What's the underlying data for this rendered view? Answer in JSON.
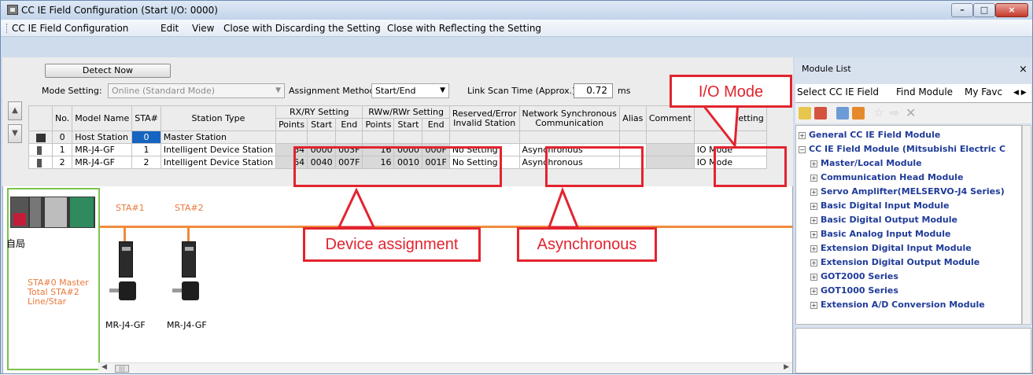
{
  "window": {
    "title": "CC IE Field Configuration (Start I/O: 0000)",
    "controls": {
      "minimize": "–",
      "maximize": "□",
      "close": "×"
    }
  },
  "menu": [
    "CC IE Field Configuration",
    "Edit",
    "View",
    "Close with Discarding the Setting",
    "Close with Reflecting the Setting"
  ],
  "settings": {
    "detect_now": "Detect Now",
    "mode_label": "Mode Setting:",
    "mode_value": "Online (Standard Mode)",
    "assign_label": "Assignment Method:",
    "assign_value": "Start/End",
    "scan_label": "Link Scan Time (Approx.):",
    "scan_value": "0.72",
    "scan_unit": "ms"
  },
  "table": {
    "headers": {
      "no": "No.",
      "model": "Model Name",
      "sta": "STA#",
      "type": "Station Type",
      "rxry": "RX/RY Setting",
      "rwwr": "RWw/RWr Setting",
      "points": "Points",
      "start": "Start",
      "end": "End",
      "reserved": "Reserved/Error",
      "reserved2": "Invalid Station",
      "netsync": "Network Synchronous",
      "netsync2": "Communication",
      "alias": "Alias",
      "comment": "Comment",
      "mode": "Mode setting",
      "mode_visible": "ode setting"
    },
    "rows": [
      {
        "no": "0",
        "model": "Host Station",
        "sta": "0",
        "type": "Master Station",
        "rx_points": "",
        "rx_start": "",
        "rx_end": "",
        "rw_points": "",
        "rw_start": "",
        "rw_end": "",
        "reserved": "",
        "sync": "",
        "mode": ""
      },
      {
        "no": "1",
        "model": "MR-J4-GF",
        "sta": "1",
        "type": "Intelligent Device Station",
        "rx_points": "64",
        "rx_start": "0000",
        "rx_end": "003F",
        "rw_points": "16",
        "rw_start": "0000",
        "rw_end": "000F",
        "reserved": "No Setting",
        "sync": "Asynchronous",
        "mode": "IO Mode"
      },
      {
        "no": "2",
        "model": "MR-J4-GF",
        "sta": "2",
        "type": "Intelligent Device Station",
        "rx_points": "64",
        "rx_start": "0040",
        "rx_end": "007F",
        "rw_points": "16",
        "rw_start": "0010",
        "rw_end": "001F",
        "reserved": "No Setting",
        "sync": "Asynchronous",
        "mode": "IO Mode"
      }
    ]
  },
  "diagram": {
    "host_label": "自局",
    "sta_labels": [
      "STA#1",
      "STA#2"
    ],
    "info_lines": [
      "STA#0  Master",
      "Total STA#2",
      "Line/Star"
    ],
    "device_names": [
      "MR-J4-GF",
      "MR-J4-GF"
    ]
  },
  "callouts": {
    "io_mode": "I/O Mode",
    "device_assignment": "Device assignment",
    "asynchronous": "Asynchronous"
  },
  "module_list": {
    "title": "Module List",
    "close": "×",
    "tabs": [
      "Select CC IE Field",
      "Find Module",
      "My Favc"
    ],
    "tab_nav": "◀ ▶",
    "tree": [
      "General CC IE Field Module",
      "CC IE Field Module (Mitsubishi Electric C",
      "Master/Local Module",
      "Communication Head Module",
      "Servo Amplifter(MELSERVO-J4 Series)",
      "Basic Digital Input Module",
      "Basic Digital Output Module",
      "Basic Analog Input Module",
      "Extension Digital Input Module",
      "Extension Digital Output Module",
      "GOT2000 Series",
      "GOT1000 Series",
      "Extension A/D Conversion Module"
    ]
  },
  "colors": {
    "callout_red": "#e2242f",
    "network_orange": "#f08a3c",
    "tree_blue": "#1f3b99",
    "green_frame": "#7cc34c"
  }
}
